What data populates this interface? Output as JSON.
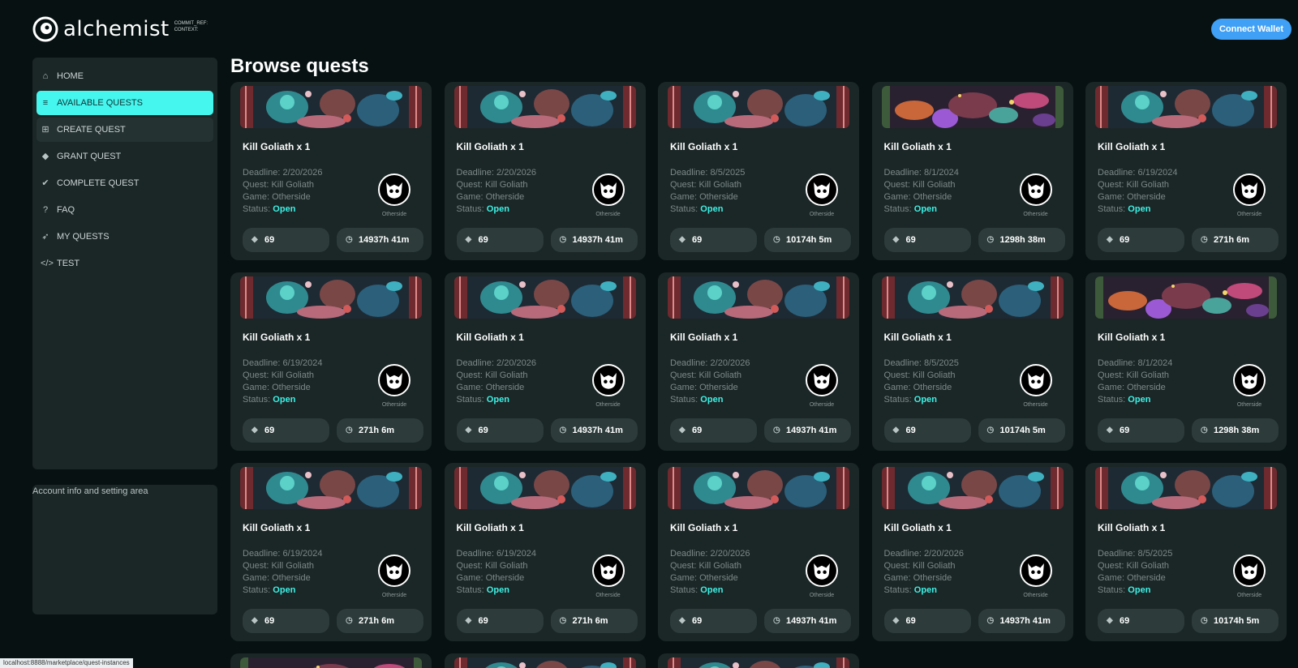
{
  "logo": {
    "name": "alchemist",
    "sub_line1": "COMMIT_REF:",
    "sub_line2": "CONTEXT:"
  },
  "header": {
    "connect_label": "Connect Wallet"
  },
  "sidebar": {
    "items": [
      {
        "label": "HOME",
        "icon": "home-icon",
        "glyph": "⌂",
        "state": "normal"
      },
      {
        "label": "AVAILABLE QUESTS",
        "icon": "list-icon",
        "glyph": "≡",
        "state": "active"
      },
      {
        "label": "CREATE QUEST",
        "icon": "add-square-icon",
        "glyph": "⊞",
        "state": "hover"
      },
      {
        "label": "GRANT QUEST",
        "icon": "grant-icon",
        "glyph": "◆",
        "state": "normal"
      },
      {
        "label": "COMPLETE QUEST",
        "icon": "check-icon",
        "glyph": "✔",
        "state": "normal"
      },
      {
        "label": "FAQ",
        "icon": "question-icon",
        "glyph": "?",
        "state": "normal"
      },
      {
        "label": "MY QUESTS",
        "icon": "rocket-icon",
        "glyph": "➶",
        "state": "normal"
      },
      {
        "label": "TEST",
        "icon": "code-icon",
        "glyph": "</>",
        "state": "normal"
      }
    ]
  },
  "account": {
    "label": "Account info and setting area"
  },
  "main": {
    "title": "Browse quests"
  },
  "card_labels": {
    "deadline": "Deadline: ",
    "quest": "Quest: ",
    "game": "Game: ",
    "status": "Status: "
  },
  "quests": [
    {
      "title": "Kill Goliath x 1",
      "deadline": "2/20/2026",
      "quest": "Kill Goliath",
      "game": "Otherside",
      "status": "Open",
      "reward": "69",
      "time": "14937h 41m",
      "banner": "teal",
      "game_label": "Otherside"
    },
    {
      "title": "Kill Goliath x 1",
      "deadline": "2/20/2026",
      "quest": "Kill Goliath",
      "game": "Otherside",
      "status": "Open",
      "reward": "69",
      "time": "14937h 41m",
      "banner": "teal",
      "game_label": "Otherside"
    },
    {
      "title": "Kill Goliath x 1",
      "deadline": "8/5/2025",
      "quest": "Kill Goliath",
      "game": "Otherside",
      "status": "Open",
      "reward": "69",
      "time": "10174h 5m",
      "banner": "teal",
      "game_label": "Otherside"
    },
    {
      "title": "Kill Goliath x 1",
      "deadline": "8/1/2024",
      "quest": "Kill Goliath",
      "game": "Otherside",
      "status": "Open",
      "reward": "69",
      "time": "1298h 38m",
      "banner": "mushroom",
      "game_label": "Otherside"
    },
    {
      "title": "Kill Goliath x 1",
      "deadline": "6/19/2024",
      "quest": "Kill Goliath",
      "game": "Otherside",
      "status": "Open",
      "reward": "69",
      "time": "271h 6m",
      "banner": "teal",
      "game_label": "Otherside"
    },
    {
      "title": "Kill Goliath x 1",
      "deadline": "6/19/2024",
      "quest": "Kill Goliath",
      "game": "Otherside",
      "status": "Open",
      "reward": "69",
      "time": "271h 6m",
      "banner": "teal",
      "game_label": "Otherside"
    },
    {
      "title": "Kill Goliath x 1",
      "deadline": "2/20/2026",
      "quest": "Kill Goliath",
      "game": "Otherside",
      "status": "Open",
      "reward": "69",
      "time": "14937h 41m",
      "banner": "teal",
      "game_label": "Otherside"
    },
    {
      "title": "Kill Goliath x 1",
      "deadline": "2/20/2026",
      "quest": "Kill Goliath",
      "game": "Otherside",
      "status": "Open",
      "reward": "69",
      "time": "14937h 41m",
      "banner": "teal",
      "game_label": "Otherside"
    },
    {
      "title": "Kill Goliath x 1",
      "deadline": "8/5/2025",
      "quest": "Kill Goliath",
      "game": "Otherside",
      "status": "Open",
      "reward": "69",
      "time": "10174h 5m",
      "banner": "teal",
      "game_label": "Otherside"
    },
    {
      "title": "Kill Goliath x 1",
      "deadline": "8/1/2024",
      "quest": "Kill Goliath",
      "game": "Otherside",
      "status": "Open",
      "reward": "69",
      "time": "1298h 38m",
      "banner": "mushroom",
      "game_label": "Otherside"
    },
    {
      "title": "Kill Goliath x 1",
      "deadline": "6/19/2024",
      "quest": "Kill Goliath",
      "game": "Otherside",
      "status": "Open",
      "reward": "69",
      "time": "271h 6m",
      "banner": "teal",
      "game_label": "Otherside"
    },
    {
      "title": "Kill Goliath x 1",
      "deadline": "6/19/2024",
      "quest": "Kill Goliath",
      "game": "Otherside",
      "status": "Open",
      "reward": "69",
      "time": "271h 6m",
      "banner": "teal",
      "game_label": "Otherside"
    },
    {
      "title": "Kill Goliath x 1",
      "deadline": "2/20/2026",
      "quest": "Kill Goliath",
      "game": "Otherside",
      "status": "Open",
      "reward": "69",
      "time": "14937h 41m",
      "banner": "teal",
      "game_label": "Otherside"
    },
    {
      "title": "Kill Goliath x 1",
      "deadline": "2/20/2026",
      "quest": "Kill Goliath",
      "game": "Otherside",
      "status": "Open",
      "reward": "69",
      "time": "14937h 41m",
      "banner": "teal",
      "game_label": "Otherside"
    },
    {
      "title": "Kill Goliath x 1",
      "deadline": "8/5/2025",
      "quest": "Kill Goliath",
      "game": "Otherside",
      "status": "Open",
      "reward": "69",
      "time": "10174h 5m",
      "banner": "teal",
      "game_label": "Otherside"
    }
  ],
  "partial_banners": [
    "mushroom",
    "teal",
    "teal"
  ],
  "status_bar": {
    "url": "localhost:8888/marketplace/quest-instances"
  },
  "colors": {
    "accent": "#45f6ef",
    "status_open": "#3df2e6",
    "button_blue": "#3fa0f5",
    "card_bg": "#1b2626",
    "page_bg": "#071111"
  }
}
